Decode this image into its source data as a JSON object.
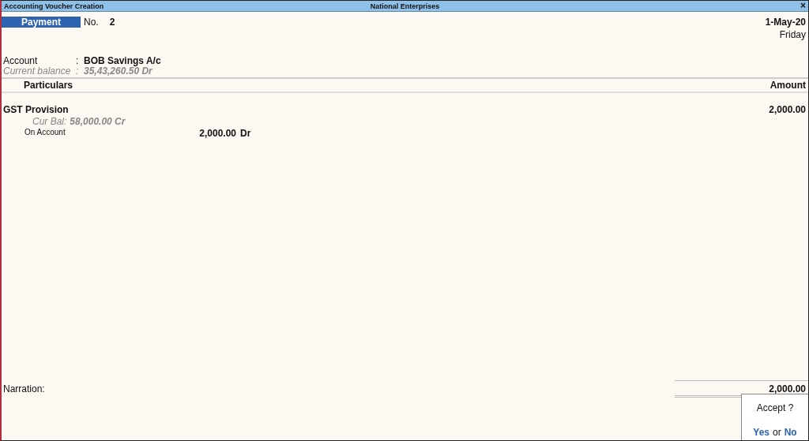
{
  "window": {
    "title": "Accounting Voucher Creation",
    "company": "National Enterprises",
    "close": "×"
  },
  "voucher": {
    "type": "Payment",
    "number_label": "No.",
    "number": "2",
    "date": "1-May-20",
    "day": "Friday"
  },
  "account": {
    "label": "Account",
    "colon": ":",
    "value": "BOB Savings A/c",
    "balance_label": "Current balance",
    "balance_colon": ":",
    "balance": "35,43,260.50 Dr"
  },
  "table": {
    "columns": [
      "Particulars",
      "Amount"
    ],
    "rows": [
      {
        "ledger": "GST Provision",
        "amount": "2,000.00",
        "cur_bal_label": "Cur Bal:",
        "cur_bal": "58,000.00 Cr",
        "bill_type": "On Account",
        "bill_amount": "2,000.00",
        "bill_side": "Dr"
      }
    ]
  },
  "narration": {
    "label": "Narration:"
  },
  "total": "2,000.00",
  "dialog": {
    "title": "Accept ?",
    "yes": "Yes",
    "or": "or",
    "no": "No"
  }
}
